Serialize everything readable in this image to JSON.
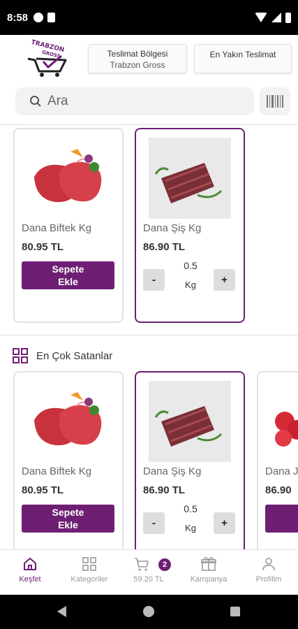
{
  "status_bar": {
    "time": "8:58"
  },
  "header": {
    "logo_text": "TRABZON GROSS",
    "delivery_region_label": "Teslimat Bölgesi",
    "delivery_region_value": "Trabzon Gross",
    "nearest_delivery_label": "En Yakın Teslimat",
    "search_placeholder": "Ara"
  },
  "top_products": [
    {
      "name": "Dana Biftek Kg",
      "price": "80.95 TL",
      "add_label": "Sepete Ekle"
    },
    {
      "name": "Dana Şiş Kg",
      "price": "86.90 TL",
      "qty_minus": "-",
      "qty_value": "0.5",
      "qty_unit": "Kg",
      "qty_plus": "+"
    }
  ],
  "best_sellers": {
    "title": "En Çok Satanlar",
    "products": [
      {
        "name": "Dana Biftek Kg",
        "price": "80.95 TL",
        "add_label": "Sepete Ekle"
      },
      {
        "name": "Dana Şiş Kg",
        "price": "86.90 TL",
        "qty_minus": "-",
        "qty_value": "0.5",
        "qty_unit": "Kg",
        "qty_plus": "+"
      },
      {
        "name": "Dana J",
        "price": "86.90",
        "add_label": "S"
      }
    ]
  },
  "bottom_nav": {
    "items": [
      {
        "label": "Keşfet",
        "icon": "home-icon",
        "active": true
      },
      {
        "label": "Kategoriler",
        "icon": "grid-icon"
      },
      {
        "label": "59.20 TL",
        "icon": "cart-icon",
        "badge": "2"
      },
      {
        "label": "Kampanya",
        "icon": "gift-icon"
      },
      {
        "label": "Profilim",
        "icon": "user-icon"
      }
    ]
  },
  "colors": {
    "brand": "#6e1f74",
    "button_grey": "#dddddd",
    "search_bg": "#f2f2f2"
  }
}
